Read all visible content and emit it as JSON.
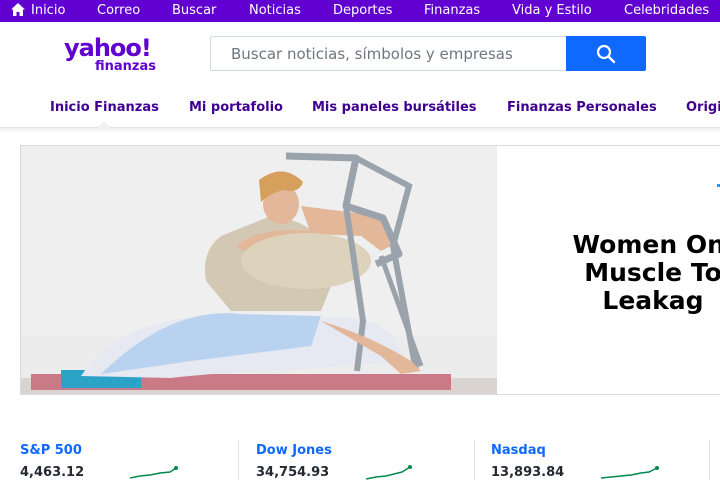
{
  "topbar": {
    "items": [
      "Inicio",
      "Correo",
      "Buscar",
      "Noticias",
      "Deportes",
      "Finanzas",
      "Vida y Estilo",
      "Celebridades"
    ]
  },
  "logo": {
    "brand": "yahoo!",
    "product": "finanzas"
  },
  "search": {
    "placeholder": "Buscar noticias, símbolos y empresas"
  },
  "nav": {
    "items": [
      "Inicio Finanzas",
      "Mi portafolio",
      "Mis paneles bursátiles",
      "Finanzas Personales",
      "Origi"
    ],
    "active": "Inicio Finanzas"
  },
  "ad": {
    "headline_lines": [
      "Women Onl",
      "Muscle To",
      "Leakag"
    ]
  },
  "tickers": [
    {
      "name": "S&P 500",
      "price": "4,463.12",
      "trend": "up"
    },
    {
      "name": "Dow Jones",
      "price": "34,754.93",
      "trend": "up"
    },
    {
      "name": "Nasdaq",
      "price": "13,893.84",
      "trend": "up"
    }
  ],
  "colors": {
    "brand": "#6001d2",
    "accent": "#0f69ff",
    "positive": "#008a4b"
  }
}
